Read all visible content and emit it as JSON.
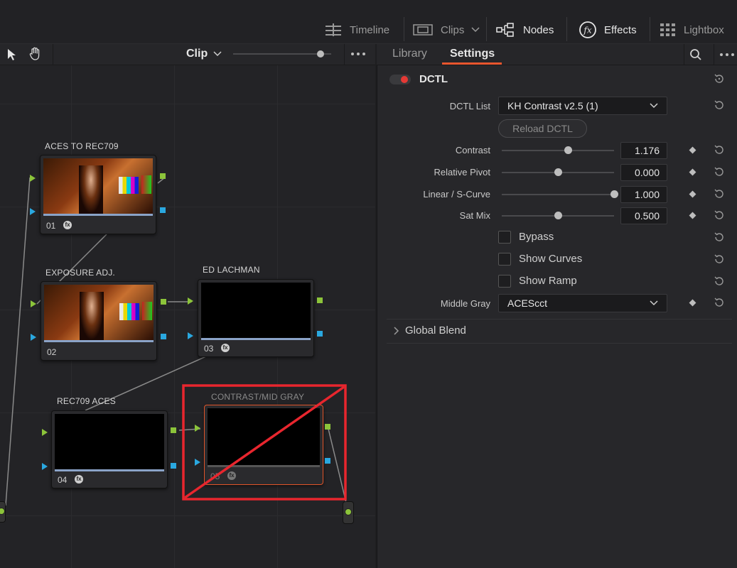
{
  "topbar": {
    "items": [
      {
        "label": "Timeline",
        "icon": "timeline-icon"
      },
      {
        "label": "Clips",
        "icon": "clips-icon"
      },
      {
        "label": "Nodes",
        "icon": "nodes-icon"
      },
      {
        "label": "Effects",
        "icon": "fx-icon"
      },
      {
        "label": "Lightbox",
        "icon": "lightbox-icon"
      }
    ]
  },
  "node_toolbar": {
    "mode_label": "Clip"
  },
  "nodes": {
    "n1": {
      "title": "ACES TO REC709",
      "num": "01"
    },
    "n2": {
      "title": "EXPOSURE ADJ.",
      "num": "02"
    },
    "n3": {
      "title": "ED LACHMAN",
      "num": "03"
    },
    "n4": {
      "title": "REC709 ACES",
      "num": "04"
    },
    "n5": {
      "title": "CONTRAST/MID GRAY",
      "num": "05"
    }
  },
  "right_tabs": {
    "library": "Library",
    "settings": "Settings"
  },
  "dctl": {
    "title": "DCTL",
    "list_label": "DCTL List",
    "list_value": "KH Contrast v2.5 (1)",
    "reload_label": "Reload DCTL",
    "params": [
      {
        "label": "Contrast",
        "value": "1.176",
        "fraction": 0.59
      },
      {
        "label": "Relative Pivot",
        "value": "0.000",
        "fraction": 0.5
      },
      {
        "label": "Linear / S-Curve",
        "value": "1.000",
        "fraction": 1.0
      },
      {
        "label": "Sat Mix",
        "value": "0.500",
        "fraction": 0.5
      }
    ],
    "checkboxes": [
      {
        "label": "Bypass",
        "checked": false
      },
      {
        "label": "Show Curves",
        "checked": false
      },
      {
        "label": "Show Ramp",
        "checked": false
      }
    ],
    "middle_gray_label": "Middle Gray",
    "middle_gray_value": "ACEScct",
    "global_blend_label": "Global Blend"
  },
  "colors": {
    "accent_red": "#e8262e",
    "toggle_red": "#e53935",
    "port_green": "#8cc43a",
    "port_blue": "#2aa8e0",
    "settings_underline": "#e8562e"
  }
}
